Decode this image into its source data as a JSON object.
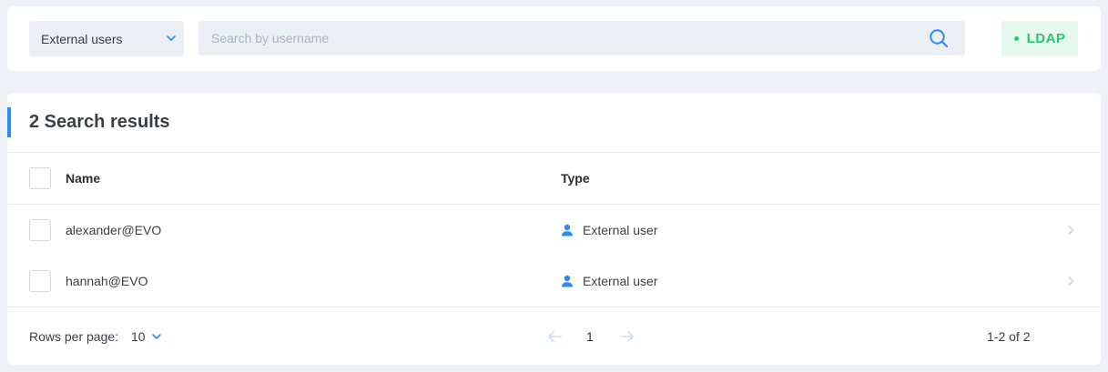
{
  "filter": {
    "selected": "External users",
    "icon": "chevron-down-icon"
  },
  "search": {
    "placeholder": "Search by username",
    "value": "",
    "icon": "search-icon"
  },
  "badge": {
    "label": "LDAP",
    "color": "#28c76f"
  },
  "results": {
    "title": "2 Search results",
    "columns": {
      "name": "Name",
      "type": "Type"
    },
    "rows": [
      {
        "name": "alexander@EVO",
        "type": "External user",
        "type_icon": "user-icon"
      },
      {
        "name": "hannah@EVO",
        "type": "External user",
        "type_icon": "user-icon"
      }
    ]
  },
  "pagination": {
    "rows_per_page_label": "Rows per page:",
    "rows_per_page": "10",
    "current_page": "1",
    "range": "1-2 of 2"
  },
  "colors": {
    "accent": "#2d8cf0",
    "success": "#28c76f",
    "background": "#eef1f5"
  }
}
